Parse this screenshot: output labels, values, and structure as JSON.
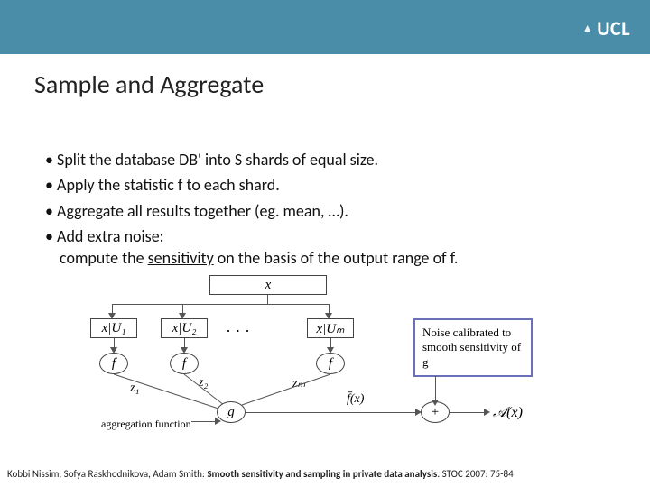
{
  "banner": {
    "logo": "UCL"
  },
  "title": "Sample and Aggregate",
  "bullets": {
    "b1": "Split the database DB' into S shards of equal size.",
    "b2": "Apply the statistic f to each shard.",
    "b3": "Aggregate all results together (eg. mean, …).",
    "b4": "Add extra noise:",
    "b4b": "compute the sensitivity on the basis of the output range of f."
  },
  "diagram": {
    "x": "x",
    "shard1": "x|U₁",
    "shard2": "x|U₂",
    "dots": "· · ·",
    "shardm": "x|Uₘ",
    "f": "f",
    "z1": "z₁",
    "z2": "z₂",
    "zm": "zₘ",
    "g": "g",
    "agg_label": "aggregation function",
    "fbar": "f̄(x)",
    "plus": "+",
    "A": "𝒜(x)",
    "noise_note": "Noise calibrated to smooth sensitivity of g"
  },
  "citation": {
    "authors": "Kobbi Nissim, Sofya Raskhodnikova, Adam Smith: ",
    "title": "Smooth sensitivity and sampling in private data analysis",
    "venue": ". STOC 2007: 75-84"
  }
}
